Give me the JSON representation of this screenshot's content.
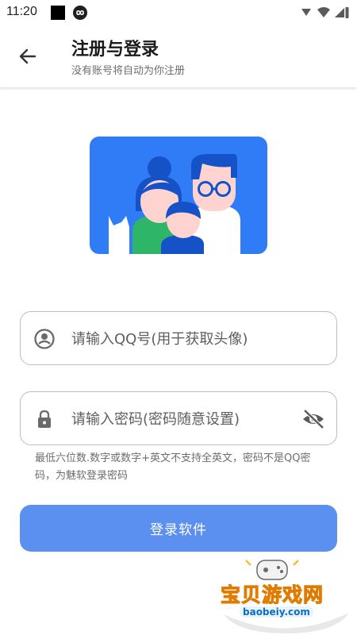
{
  "status_bar": {
    "time": "11:20"
  },
  "header": {
    "title": "注册与登录",
    "subtitle": "没有账号将自动为你注册"
  },
  "form": {
    "qq_placeholder": "请输入QQ号(用于获取头像)",
    "qq_value": "",
    "password_placeholder": "请输入密码(密码随意设置)",
    "password_value": "",
    "hint": "最低六位数.数字或数字+英文不支持全英文，密码不是QQ密码，为魅软登录密码",
    "login_label": "登录软件"
  },
  "watermark": {
    "text": "宝贝游戏网",
    "url": "baobeiy.com"
  },
  "colors": {
    "primary": "#5b8ff0",
    "illustration_bg": "#2f7cf6",
    "text_secondary": "#6d6d6d"
  }
}
